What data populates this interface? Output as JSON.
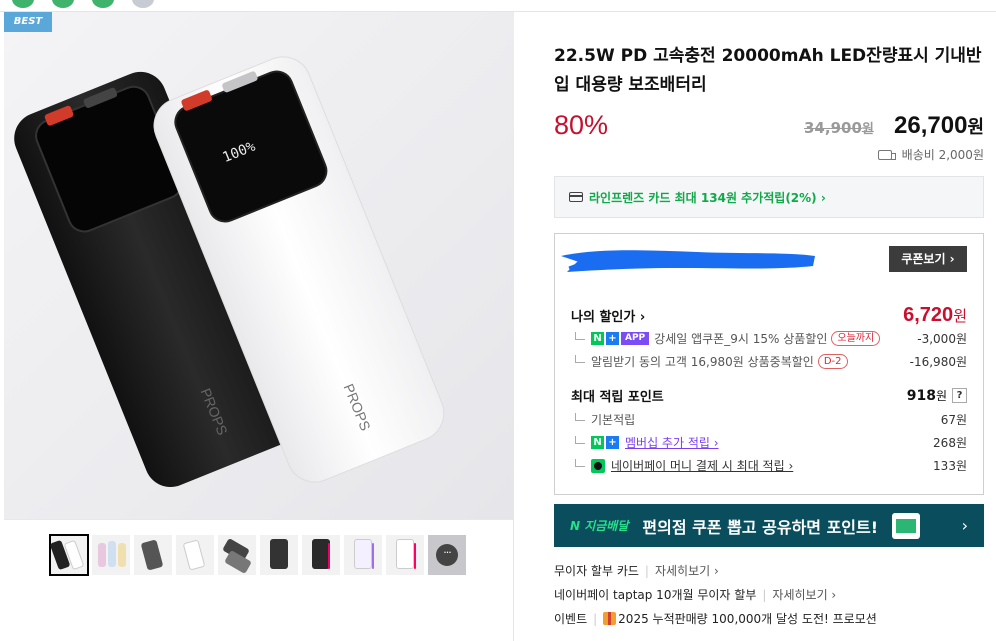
{
  "badge": "BEST",
  "product": {
    "title": "22.5W PD 고속충전 20000mAh LED잔량표시 기내반입 대용량 보조배터리",
    "discount_rate": "80%",
    "original_price": "34,900",
    "original_unit": "원",
    "price": "26,700",
    "price_unit": "원",
    "shipping": "배송비 2,000원",
    "brand_print": "PROPS",
    "display_text": "100%"
  },
  "card_promo": "라인프렌즈 카드 최대 134원 추가적립(2%) ›",
  "benefits": {
    "coupon_button": "쿠폰보기 ›",
    "my_discount_label": "나의 할인가",
    "my_discount_value": "6,720",
    "my_discount_unit": "원",
    "discount_items": [
      {
        "badges": [
          "N",
          "+",
          "APP"
        ],
        "label": "강세일 앱쿠폰_9시 15% 상품할인",
        "pill": "오늘까지",
        "value": "-3,000원"
      },
      {
        "badges": [],
        "label": "알림받기 동의 고객 16,980원 상품중복할인",
        "pill": "D-2",
        "value": "-16,980원"
      }
    ],
    "points_label": "최대 적립 포인트",
    "points_value": "918",
    "points_unit": "원",
    "points_help": "?",
    "point_items": [
      {
        "label": "기본적립",
        "value": "67원"
      },
      {
        "label": "멤버십 추가 적립 ›",
        "value": "268원"
      },
      {
        "label": "네이버페이 머니 결제 시 최대 적립 ›",
        "value": "133원"
      }
    ]
  },
  "banner": {
    "logo": "N 지금배달",
    "text": "편의점 쿠폰 뽑고 공유하면 포인트!",
    "chevron": "›"
  },
  "info_rows": [
    {
      "label": "무이자 할부 카드",
      "link": "자세히보기 ›"
    },
    {
      "label": "네이버페이 taptap 10개월 무이자 할부",
      "link": "자세히보기 ›"
    },
    {
      "label": "이벤트",
      "link": "2025 누적판매량 100,000개 달성 도전! 프로모션"
    }
  ],
  "colors": {
    "discount_red": "#c8102e",
    "naver_green": "#03c75a",
    "banner_bg": "#0a4d5c",
    "purple": "#7b3ef0",
    "scribble_blue": "#1a6cf0"
  },
  "thumbnails": [
    "thumb-1",
    "thumb-2",
    "thumb-3",
    "thumb-4",
    "thumb-5",
    "thumb-6",
    "thumb-7",
    "thumb-8",
    "thumb-9",
    "thumb-10"
  ],
  "more_icon": "···"
}
